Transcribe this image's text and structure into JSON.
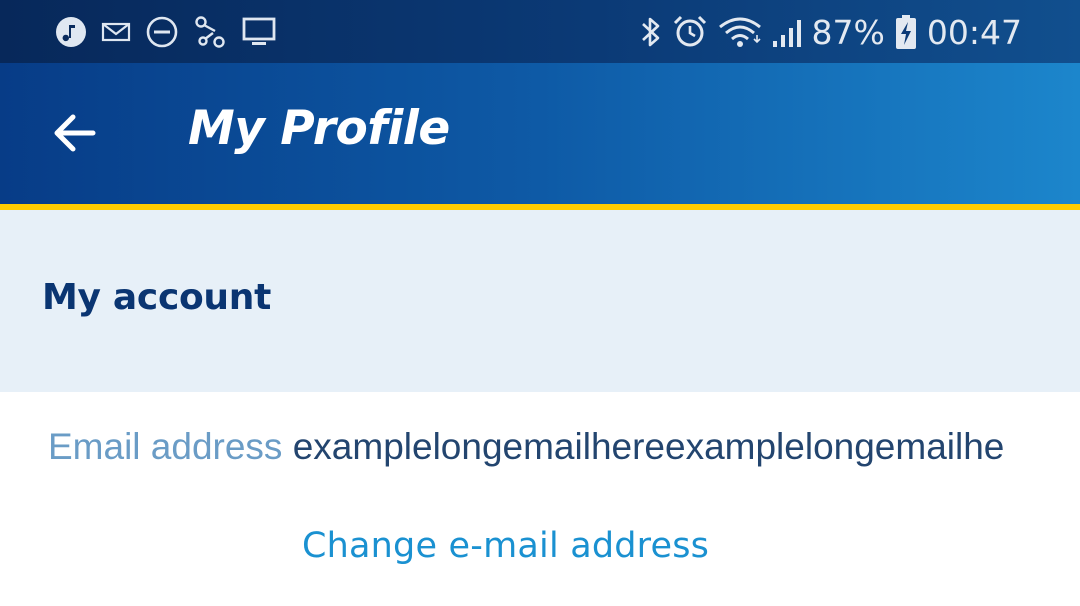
{
  "status_bar": {
    "left_icons": [
      "music-icon",
      "mail-icon",
      "do-not-disturb-icon",
      "share-icon",
      "screen-cast-icon"
    ],
    "right_icons": [
      "bluetooth-icon",
      "alarm-icon",
      "wifi-icon",
      "signal-icon",
      "battery-charging-icon"
    ],
    "battery": "87%",
    "time": "00:47"
  },
  "app_bar": {
    "back_icon": "arrow-back-icon",
    "title": "My Profile"
  },
  "section": {
    "title": "My account"
  },
  "account": {
    "email_label": "Email address",
    "email_value": "examplelongemailhereexamplelongemailhe",
    "change_email_link": "Change e-mail address"
  },
  "colors": {
    "status_bar": "#07285a",
    "app_bar_start": "#073c87",
    "app_bar_end": "#1c86cc",
    "accent_line": "#ffcc00",
    "section_bg": "#e7f0f8",
    "section_title": "#0a3572",
    "label": "#6a9cc6",
    "value": "#23456f",
    "link": "#1a91d1"
  }
}
